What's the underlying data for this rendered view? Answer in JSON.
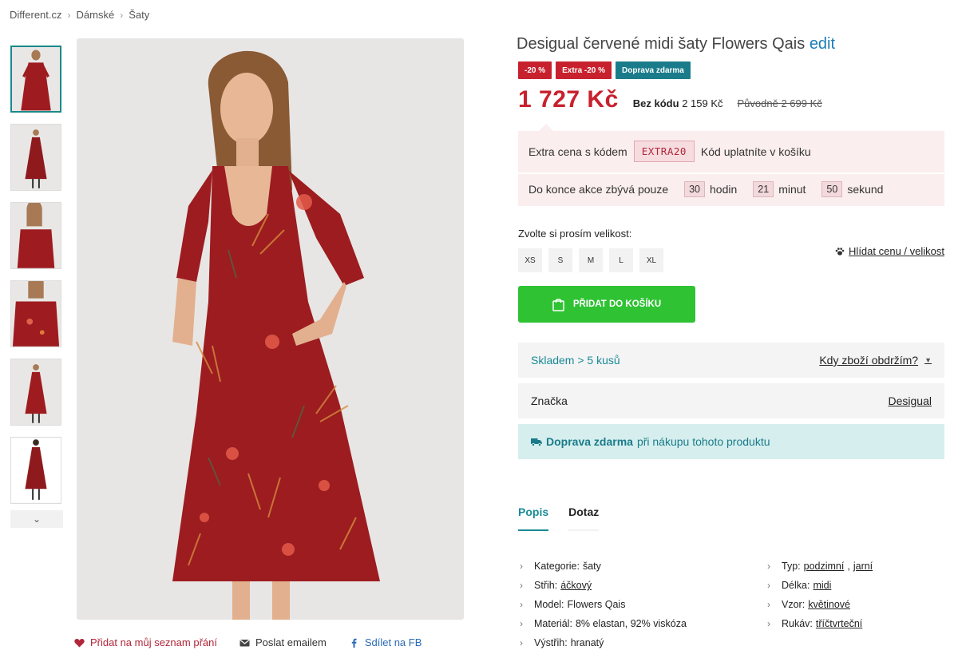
{
  "breadcrumb": [
    "Different.cz",
    "Dámské",
    "Šaty"
  ],
  "product": {
    "title": "Desigual červené midi šaty Flowers Qais",
    "edit_label": "edit",
    "badges": [
      "-20 %",
      "Extra -20 %",
      "Doprava zdarma"
    ],
    "price": "1 727 Kč",
    "nocode_prefix": "Bez kódu",
    "nocode_price": "2 159 Kč",
    "original_price": "Původně 2 699 Kč"
  },
  "promo": {
    "extra_label": "Extra cena s kódem",
    "code": "EXTRA20",
    "code_hint": "Kód uplatníte v košíku",
    "countdown_label": "Do konce akce zbývá pouze",
    "hours": "30",
    "hours_label": "hodin",
    "minutes": "21",
    "minutes_label": "minut",
    "seconds": "50",
    "seconds_label": "sekund"
  },
  "size": {
    "label": "Zvolte si prosím velikost:",
    "options": [
      "XS",
      "S",
      "M",
      "L",
      "XL"
    ],
    "watch_label": "Hlídat cenu / velikost"
  },
  "cart_button": "PŘIDAT DO KOŠÍKU",
  "stock": {
    "status": "Skladem > 5 kusů",
    "delivery_link": "Kdy zboží obdržím?"
  },
  "brand": {
    "label": "Značka",
    "value": "Desigual"
  },
  "shipping": {
    "bold": "Doprava zdarma",
    "rest": "při nákupu tohoto produktu"
  },
  "tabs": [
    "Popis",
    "Dotaz"
  ],
  "specs_left": [
    {
      "key": "Kategorie:",
      "value": "šaty",
      "link": false
    },
    {
      "key": "Střih:",
      "value": "áčkový",
      "link": true
    },
    {
      "key": "Model:",
      "value": "Flowers Qais",
      "link": false
    },
    {
      "key": "Materiál:",
      "value": "8% elastan, 92% viskóza",
      "link": false
    },
    {
      "key": "Výstřih:",
      "value": "hranatý",
      "link": false
    }
  ],
  "specs_right": [
    {
      "key": "Typ:",
      "value": "podzimní",
      "value2": "jarní"
    },
    {
      "key": "Délka:",
      "value": "midi"
    },
    {
      "key": "Vzor:",
      "value": "květinové"
    },
    {
      "key": "Rukáv:",
      "value": "tříčtvrteční"
    }
  ],
  "image_actions": {
    "wishlist": "Přidat na můj seznam přání",
    "email": "Poslat emailem",
    "facebook": "Sdílet na FB"
  },
  "colors": {
    "accent_teal": "#1a8a96",
    "price_red": "#c8212e",
    "cart_green": "#2fc233"
  }
}
